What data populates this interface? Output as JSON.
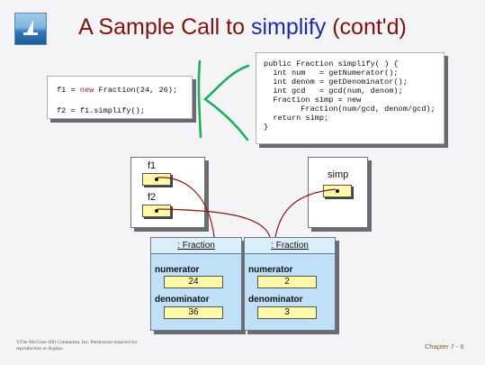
{
  "title": {
    "prefix": "A Sample Call to ",
    "keyword": "simplify",
    "suffix": " (cont'd)"
  },
  "left_code": {
    "line1": {
      "a": "f1 = ",
      "kw": "new",
      "b": " Fraction(24, 26);"
    },
    "line2": {
      "a": "f2 = f1.simplify();"
    }
  },
  "right_code": {
    "lines": [
      {
        "a": "public Fraction simplify( ) {"
      },
      {
        "a": "  int num   = getNumerator();"
      },
      {
        "a": "  int denom = getDenominator();"
      },
      {
        "a": "  int gcd   = gcd(num, denom);"
      },
      {
        "a": "  Fraction simp = new"
      },
      {
        "a": "        Fraction(num/gcd, denom/gcd);"
      },
      {
        "a": "  return simp;"
      },
      {
        "a": "}"
      }
    ]
  },
  "vars": {
    "f1": "f1",
    "f2": "f2",
    "simp": "simp"
  },
  "objects": [
    {
      "header": ": Fraction",
      "numerator_label": "numerator",
      "numerator": "24",
      "denominator_label": "denominator",
      "denominator": "36"
    },
    {
      "header": ": Fraction",
      "numerator_label": "numerator",
      "numerator": "2",
      "denominator_label": "denominator",
      "denominator": "3"
    }
  ],
  "footer": {
    "copyright": "©The McGraw-Hill Companies, Inc. Permission required for reproduction or display.",
    "chapter": "Chapter 7 - 6"
  }
}
